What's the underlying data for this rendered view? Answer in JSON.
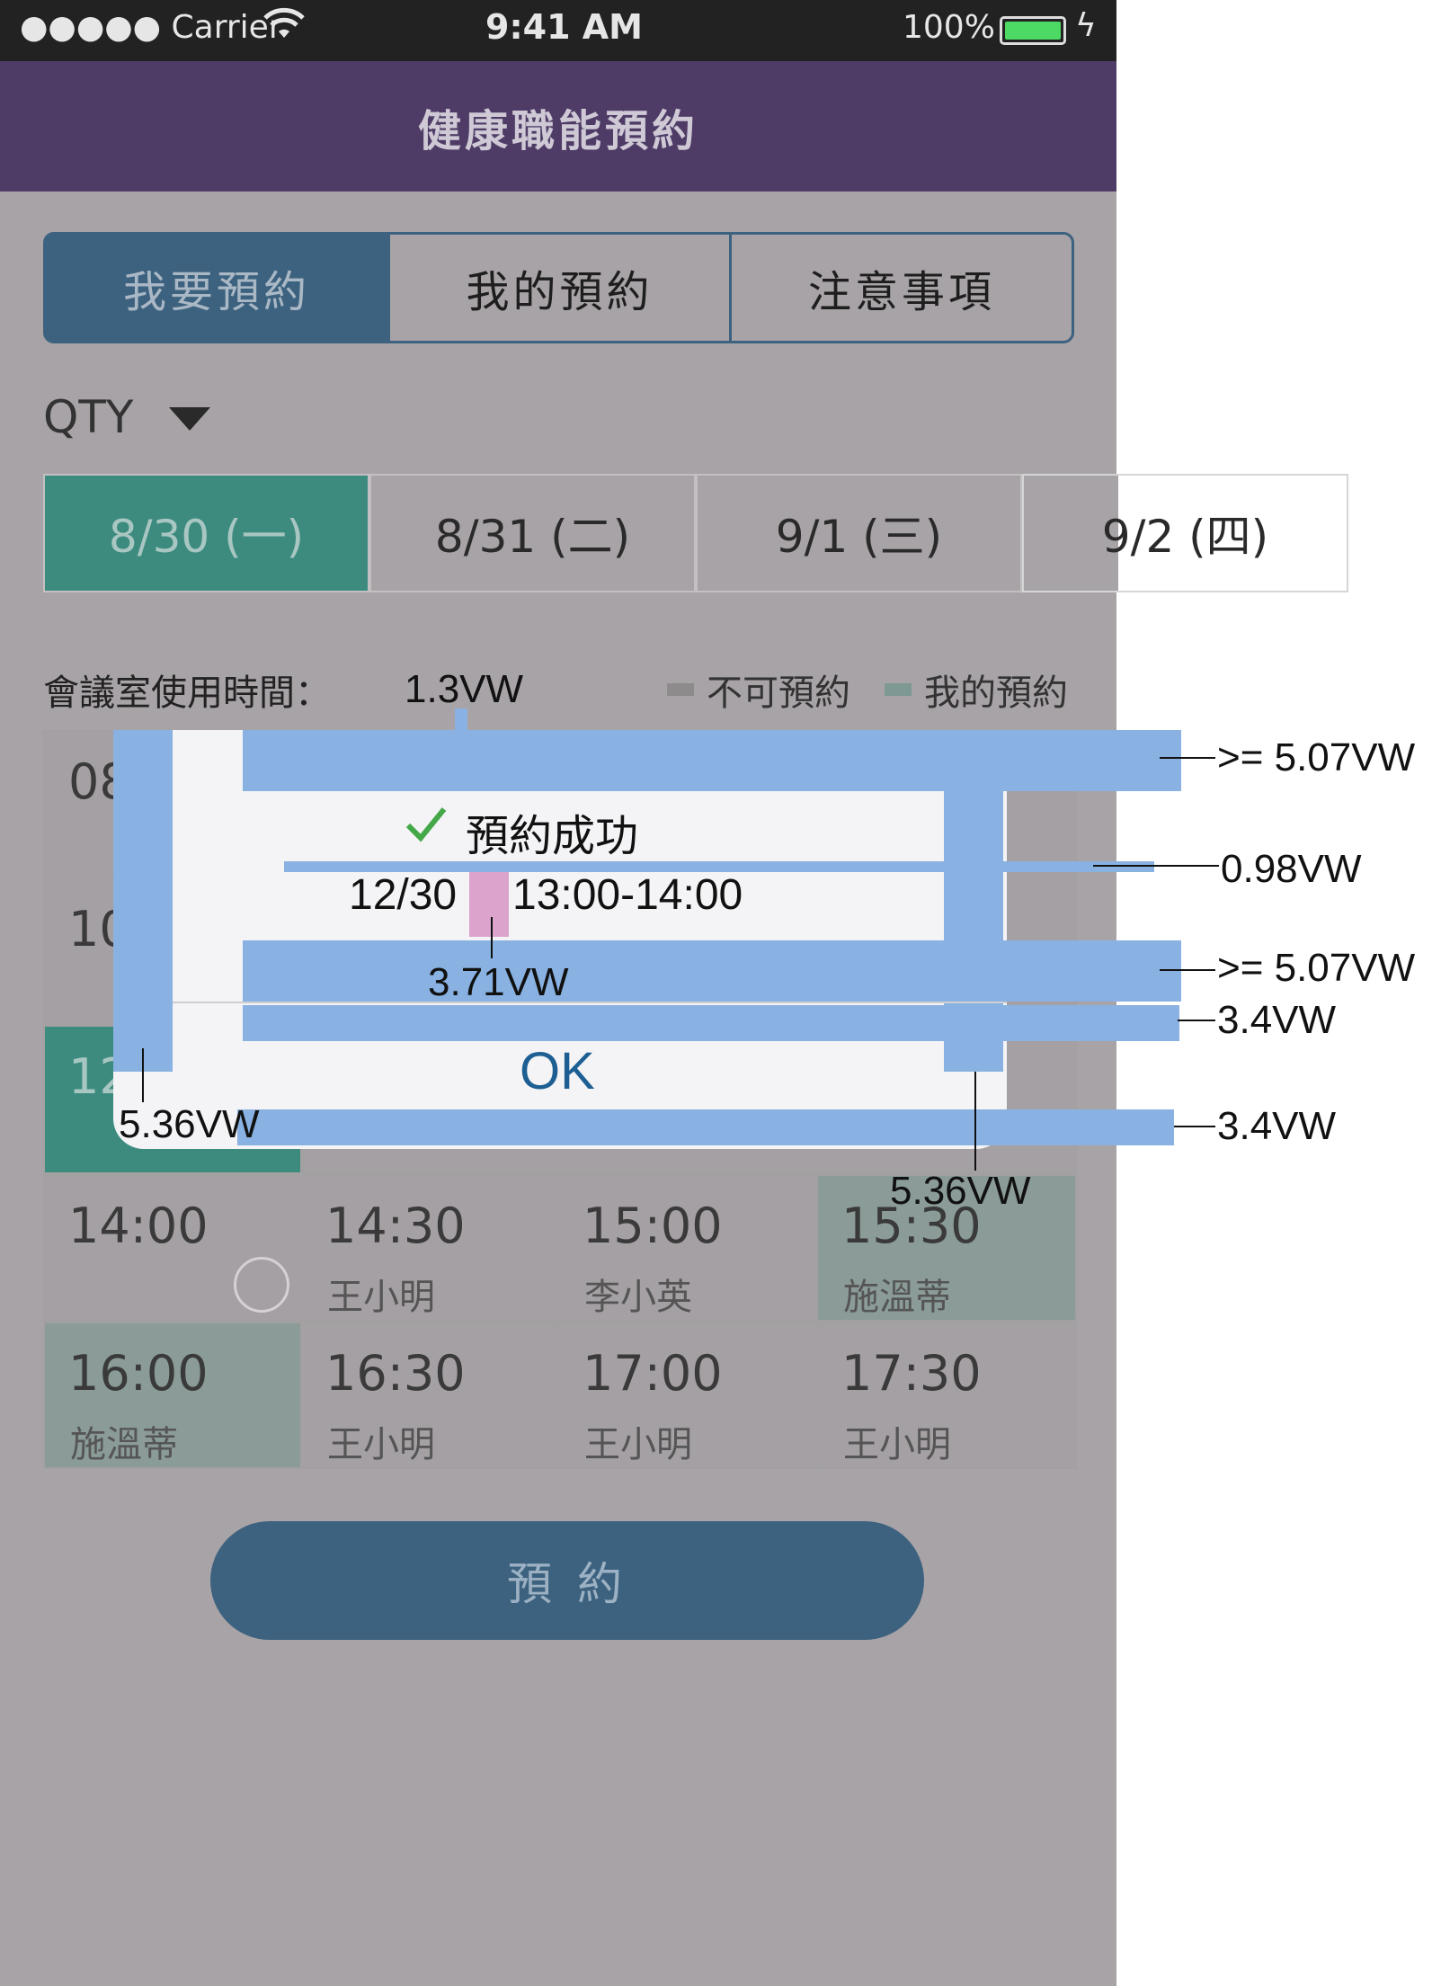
{
  "status_bar": {
    "signal": "●●●●● Carrier",
    "time": "9:41 AM",
    "battery": "100%"
  },
  "nav": {
    "title": "健康職能預約"
  },
  "tabs": [
    {
      "label": "我要預約",
      "active": true
    },
    {
      "label": "我的預約",
      "active": false
    },
    {
      "label": "注意事項",
      "active": false
    }
  ],
  "room": {
    "value": "QTY"
  },
  "dates": [
    {
      "label": "8/30 (一)",
      "active": true
    },
    {
      "label": "8/31 (二)",
      "active": false
    },
    {
      "label": "9/1 (三)",
      "active": false
    },
    {
      "label": "9/2 (四)",
      "active": false
    }
  ],
  "schedule": {
    "heading": "會議室使用時間：",
    "legend_unavailable": "不可預約",
    "legend_mine": "我的預約"
  },
  "slots_partial": {
    "row1": "08",
    "row2": "10",
    "row3": "12"
  },
  "slots": [
    {
      "time": "14:00",
      "name": ""
    },
    {
      "time": "14:30",
      "name": "王小明"
    },
    {
      "time": "15:00",
      "name": "李小英"
    },
    {
      "time": "15:30",
      "name": "施溫蒂"
    },
    {
      "time": "16:00",
      "name": "施溫蒂"
    },
    {
      "time": "16:30",
      "name": "王小明"
    },
    {
      "time": "17:00",
      "name": "王小明"
    },
    {
      "time": "17:30",
      "name": "王小明"
    }
  ],
  "reserve_button": "預 約",
  "dialog": {
    "title": "預約成功",
    "date": "12/30",
    "time_range": "13:00-14:00",
    "ok": "OK"
  },
  "annotations": {
    "top_padding": "1.3VW",
    "gap_right_top": ">= 5.07VW",
    "line_gap": "0.98VW",
    "gap_right_bottom": ">= 5.07VW",
    "divider_gap": "3.4VW",
    "bottom_gap": "3.4VW",
    "date_gap": "3.71VW",
    "left_padding": "5.36VW",
    "right_padding": "5.36VW"
  },
  "colors": {
    "nav": "#4e3c66",
    "active_tab": "#3d627f",
    "active_date": "#3d8b7f",
    "mine_slot": "#8a9b98",
    "ok_text": "#1e5f93",
    "annotation_blue": "#89b2e2",
    "highlight_pink": "#dca3cc",
    "check_green": "#45a848"
  }
}
